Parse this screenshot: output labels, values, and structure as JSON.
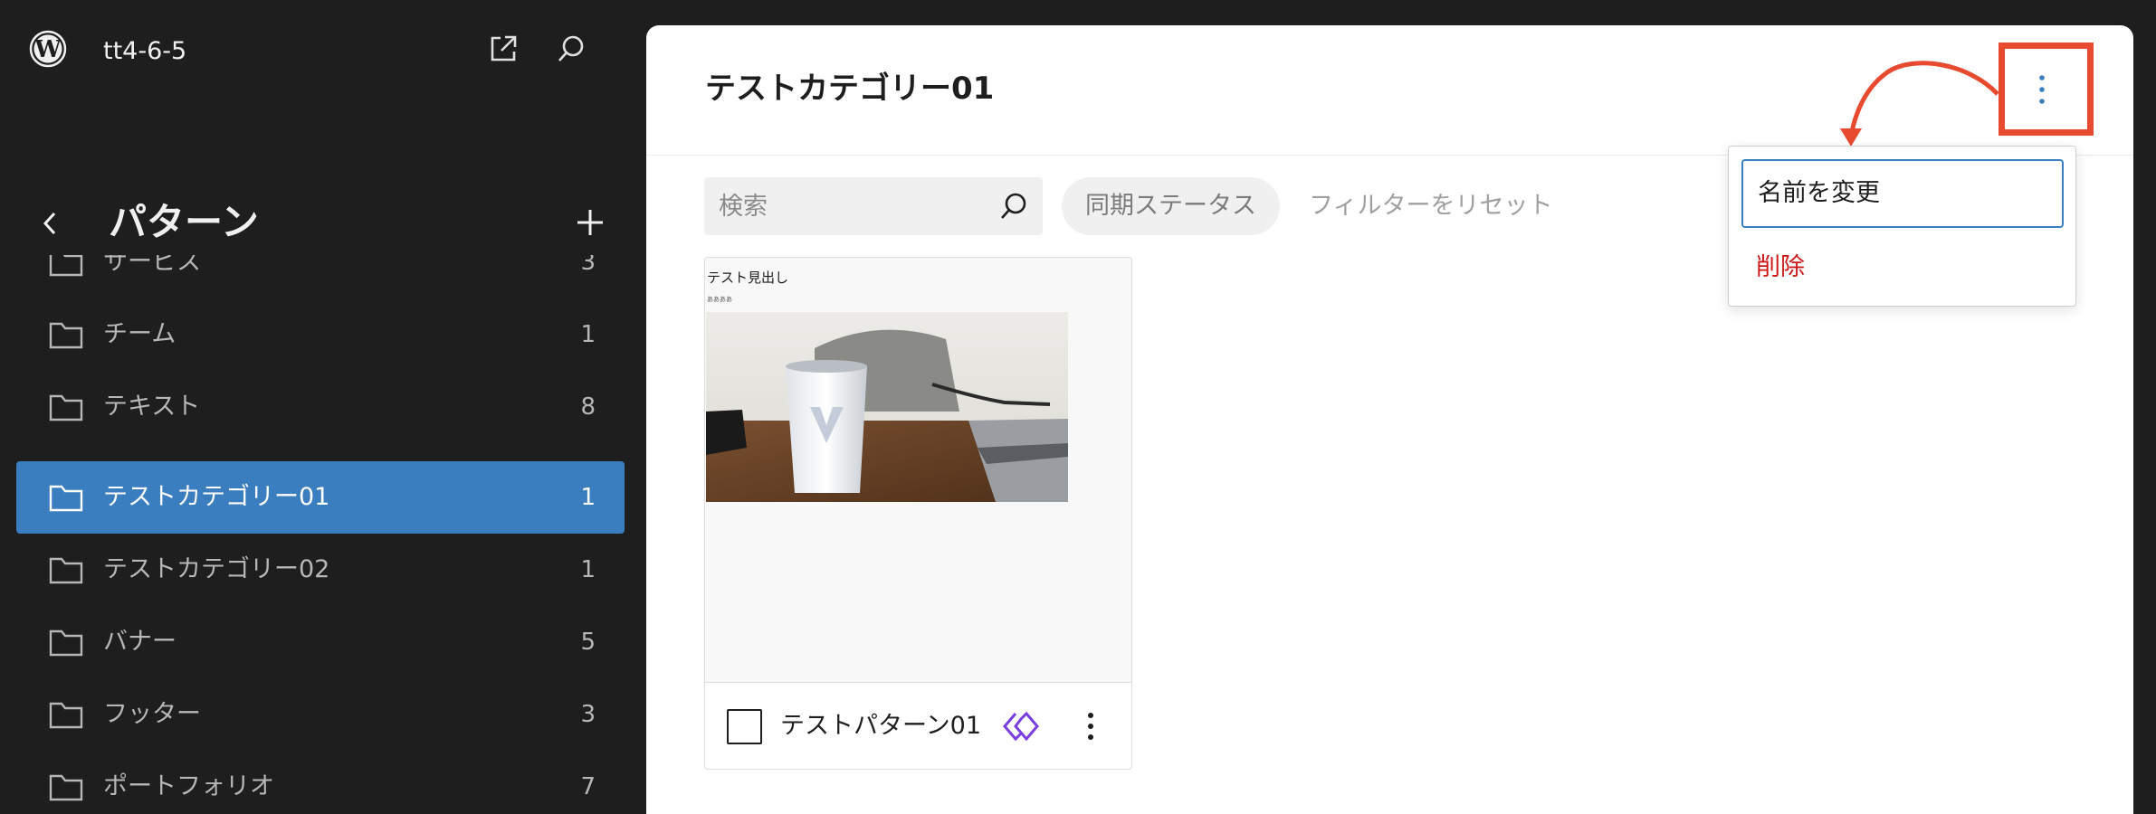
{
  "site": {
    "name": "tt4-6-5"
  },
  "sidebar": {
    "title": "パターン",
    "categories": [
      {
        "label": "サービス",
        "count": "3"
      },
      {
        "label": "チーム",
        "count": "1"
      },
      {
        "label": "テキスト",
        "count": "8"
      },
      {
        "label": "テストカテゴリー01",
        "count": "1",
        "active": true
      },
      {
        "label": "テストカテゴリー02",
        "count": "1"
      },
      {
        "label": "バナー",
        "count": "5"
      },
      {
        "label": "フッター",
        "count": "3"
      },
      {
        "label": "ポートフォリオ",
        "count": "7"
      }
    ]
  },
  "main": {
    "title": "テストカテゴリー01",
    "search": {
      "placeholder": "検索"
    },
    "filters": {
      "sync_status": "同期ステータス",
      "reset": "フィルターをリセット"
    },
    "patterns": [
      {
        "title": "テストパターン01",
        "preview": {
          "heading": "テスト見出し",
          "text": "ああああ"
        }
      }
    ]
  },
  "dropdown": {
    "rename": "名前を変更",
    "delete": "削除"
  },
  "colors": {
    "sidebar_bg": "#1e1e1e",
    "active_item": "#3b7ebf",
    "delete": "#cc1818",
    "highlight": "#e84a2f",
    "synced_icon": "#7a3ee0"
  },
  "icons": [
    "wordpress-logo",
    "external-link-icon",
    "search-icon",
    "chevron-left-icon",
    "plus-icon",
    "folder-icon",
    "synced-pattern-icon",
    "more-vertical-icon"
  ]
}
